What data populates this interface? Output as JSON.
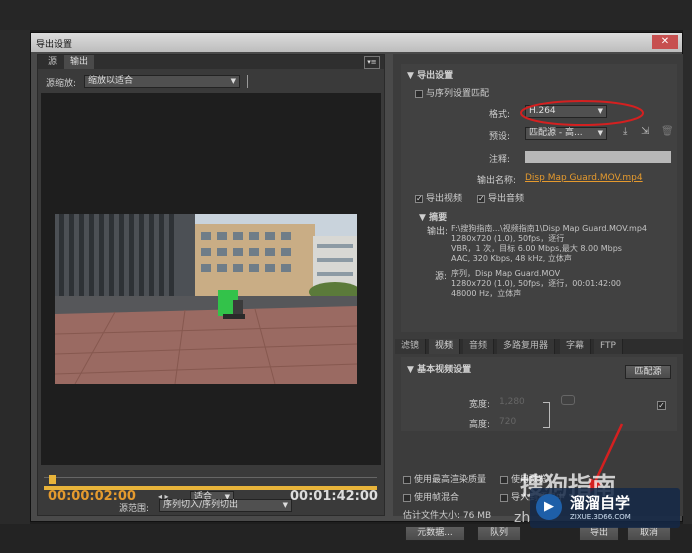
{
  "dialog": {
    "title": "导出设置",
    "close": "✕"
  },
  "left_panel": {
    "tabs": [
      "源",
      "输出"
    ],
    "source_scale_label": "源缩放:",
    "source_scale_value": "缩放以适合",
    "current_time": "00:00:02:00",
    "fit_value": "适合",
    "end_time": "00:01:42:00",
    "source_range_label": "源范围:",
    "source_range_value": "序列切入/序列切出"
  },
  "export_settings": {
    "section_title": "导出设置",
    "match_sequence_label": "与序列设置匹配",
    "format_label": "格式:",
    "format_value": "H.264",
    "preset_label": "预设:",
    "preset_value": "匹配源 - 高...",
    "comment_label": "注释:",
    "output_name_label": "输出名称:",
    "output_name_value": "Disp Map Guard.MOV.mp4",
    "export_video_label": "导出视频",
    "export_audio_label": "导出音频",
    "summary_title": "摘要",
    "output_label": "输出:",
    "output_lines": [
      "F:\\搜狗指南...\\视频指南1\\Disp Map Guard.MOV.mp4",
      "1280x720 (1.0), 50fps，逐行",
      "VBR，1 次，目标 6.00 Mbps,最大 8.00 Mbps",
      "AAC, 320 Kbps, 48 kHz, 立体声"
    ],
    "source_label": "源:",
    "source_lines": [
      "序列，Disp Map Guard.MOV",
      "1280x720 (1.0), 50fps，逐行，00:01:42:00",
      "48000 Hz，立体声"
    ]
  },
  "right_tabs": [
    "滤镜",
    "视频",
    "音频",
    "多路复用器",
    "字幕",
    "FTP"
  ],
  "video_settings": {
    "section_title": "基本视频设置",
    "match_source_button": "匹配源",
    "width_label": "宽度:",
    "width_value": "1,280",
    "height_label": "高度:",
    "height_value": "720"
  },
  "bottom_options": {
    "max_render_quality": "使用最高渲染质量",
    "use_preview": "使用预览",
    "frame_blending": "使用帧混合",
    "import_project": "导入到项目中",
    "estimated_size": "估计文件大小: 76 MB",
    "metadata_button": "元数据...",
    "queue_button": "队列",
    "export_button": "导出",
    "cancel_button": "取消"
  },
  "watermark": {
    "brand": "溜溜自学",
    "url": "ZIXUE.3D66.COM",
    "overlay": "搜狗指南",
    "site_prefix": "zh"
  },
  "colors": {
    "accent": "#e59a2e",
    "annotation": "#d42020",
    "playhead": "#e8b43a"
  }
}
